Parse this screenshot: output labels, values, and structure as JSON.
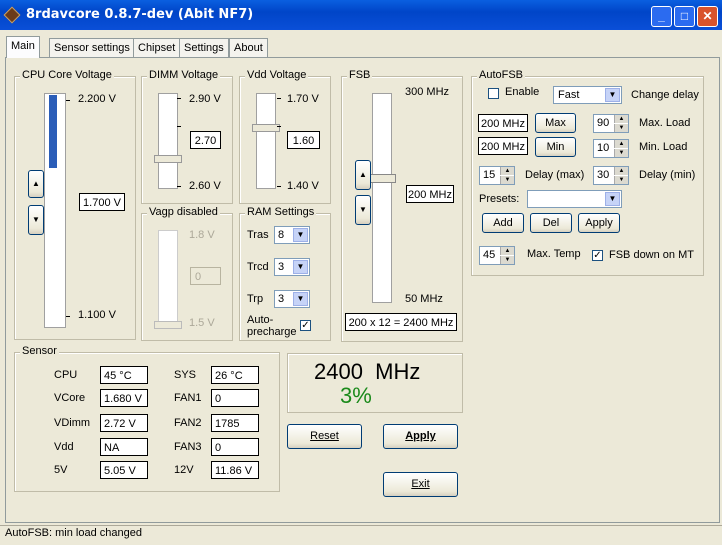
{
  "window": {
    "title": "8rdavcore 0.8.7-dev (Abit NF7)",
    "btn_min": "_",
    "btn_max": "□",
    "btn_close": "✕"
  },
  "tabs": [
    "Main",
    "Sensor settings",
    "Chipset",
    "Settings",
    "About"
  ],
  "cpu_voltage": {
    "label": "CPU Core Voltage",
    "max": "2.200 V",
    "min": "1.100 V",
    "value": "1.700 V",
    "up": "▲",
    "down": "▼"
  },
  "dimm_voltage": {
    "label": "DIMM Voltage",
    "max": "2.90 V",
    "min": "2.60 V",
    "value": "2.70"
  },
  "vdd_voltage": {
    "label": "Vdd Voltage",
    "max": "1.70 V",
    "min": "1.40 V",
    "value": "1.60"
  },
  "vagp": {
    "label": "Vagp disabled",
    "max": "1.8 V",
    "min": "1.5 V",
    "value": "0"
  },
  "ram": {
    "label": "RAM Settings",
    "tras_label": "Tras",
    "tras": "8",
    "trcd_label": "Trcd",
    "trcd": "3",
    "trp_label": "Trp",
    "trp": "3",
    "autoprecharge_label": "Auto-\nprecharge",
    "autoprecharge_checked": "✓"
  },
  "fsb": {
    "label": "FSB",
    "max": "300 MHz",
    "min": "50 MHz",
    "value": "200 MHz",
    "calc": "200 x 12 = 2400 MHz",
    "up": "▲",
    "down": "▼"
  },
  "autofsb": {
    "label": "AutoFSB",
    "enable_label": "Enable",
    "mode": "Fast",
    "change_delay_label": "Change delay",
    "max_freq": "200 MHz",
    "max_btn": "Max",
    "max_load": "90",
    "max_load_label": "Max. Load",
    "min_freq": "200 MHz",
    "min_btn": "Min",
    "min_load": "10",
    "min_load_label": "Min. Load",
    "delay_max": "15",
    "delay_max_label": "Delay (max)",
    "delay_min": "30",
    "delay_min_label": "Delay (min)",
    "presets_label": "Presets:",
    "preset_value": "",
    "add_btn": "Add",
    "del_btn": "Del",
    "apply_btn": "Apply",
    "max_temp": "45",
    "max_temp_label": "Max. Temp",
    "fsb_down_label": "FSB down on MT",
    "fsb_down_checked": "✓"
  },
  "sensor": {
    "label": "Sensor",
    "rows": [
      {
        "l1": "CPU",
        "v1": "45 °C",
        "l2": "SYS",
        "v2": "26 °C"
      },
      {
        "l1": "VCore",
        "v1": "1.680 V",
        "l2": "FAN1",
        "v2": "0"
      },
      {
        "l1": "VDimm",
        "v1": "2.72 V",
        "l2": "FAN2",
        "v2": "1785"
      },
      {
        "l1": "Vdd",
        "v1": "NA",
        "l2": "FAN3",
        "v2": "0"
      },
      {
        "l1": "5V",
        "v1": "5.05 V",
        "l2": "12V",
        "v2": "11.86 V"
      }
    ]
  },
  "display": {
    "freq": "2400  MHz",
    "load": "3%",
    "load_color": "#1a8a1a"
  },
  "buttons": {
    "reset": "Reset",
    "apply": "Apply",
    "exit": "Exit"
  },
  "status": "AutoFSB: min load changed"
}
